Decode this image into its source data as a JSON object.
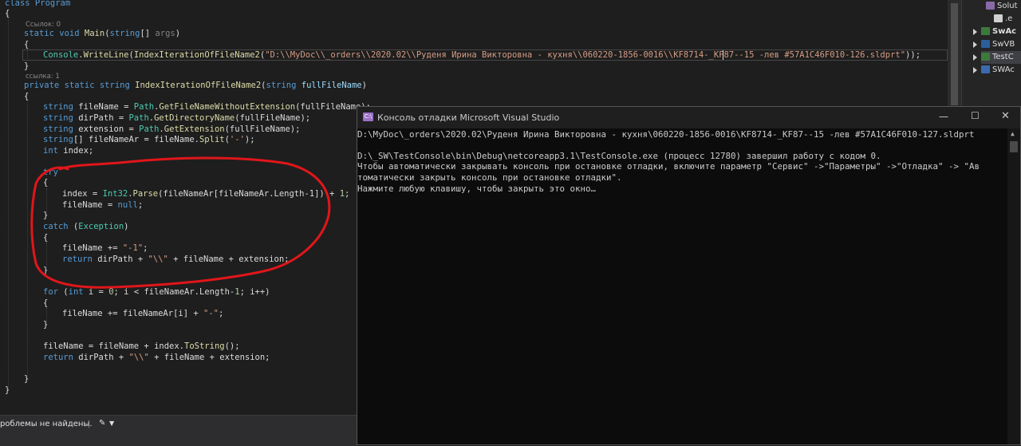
{
  "editor": {
    "class_line": "class Program",
    "open_brace": "{",
    "close_brace": "}",
    "refs_main": "Ссылок: 0",
    "refs_method": "ссылка: 1",
    "main_sig": {
      "kw1": "static",
      "kw2": "void",
      "name": "Main",
      "paren_open": "(",
      "kw3": "string",
      "rest": "[] ",
      "param": "args",
      "paren_close": ")"
    },
    "writeline": {
      "cls": "Console",
      "dot": ".",
      "mt": "WriteLine",
      "mid": "(",
      "mt2": "IndexIterationOfFileName2",
      "open": "(",
      "str": "\"D:\\\\MyDoc\\\\_orders\\\\2020.02\\\\Руденя Ирина Викторовна - кухня\\\\060220-1856-0016\\\\KF8714-_KF87--15 -лев #57A1C46F010-126.sldprt\"",
      "close": "));"
    },
    "method_sig": {
      "kw1": "private",
      "kw2": "static",
      "kw3": "string",
      "name": "IndexIterationOfFileName2",
      "open": "(",
      "kw4": "string",
      "param": " fullFileName",
      "close": ")"
    },
    "decl1": {
      "kw": "string",
      "rest": " fileName = ",
      "ty": "Path",
      "dot": ".",
      "mt": "GetFileNameWithoutExtension",
      "arg": "(fullFileName);"
    },
    "decl2": {
      "kw": "string",
      "rest": " dirPath = ",
      "ty": "Path",
      "dot": ".",
      "mt": "GetDirectoryName",
      "arg": "(fullFileName);"
    },
    "decl3": {
      "kw": "string",
      "rest": " extension = ",
      "ty": "Path",
      "dot": ".",
      "mt": "GetExtension",
      "arg": "(fullFileName);"
    },
    "decl4": {
      "kw": "string",
      "rest": "[] fileNameAr = fileName.",
      "mt": "Split",
      "open": "(",
      "str": "'-'",
      "close": ");"
    },
    "decl5": {
      "kw": "int",
      "rest": " index;"
    },
    "try_kw": "try",
    "idx_line": {
      "pre": "index = ",
      "ty": "Int32",
      "dot": ".",
      "mt": "Parse",
      "rest": "(fileNameAr[fileNameAr.Length-1]) + ",
      "num": "1",
      "end": ";"
    },
    "fn_null": {
      "pre": "fileName = ",
      "kw": "null",
      "end": ";"
    },
    "catch_line": {
      "kw": "catch",
      "open": " (",
      "ty": "Exception",
      "close": ")"
    },
    "fn_m1": {
      "pre": "fileName += ",
      "str": "\"-1\"",
      "end": ";"
    },
    "ret1": {
      "kw": "return",
      "pre": " dirPath + ",
      "str": "\"\\\\\"",
      "rest": " + fileName + extension;"
    },
    "for_line": {
      "kw": "for",
      "open": " (",
      "kw2": "int",
      "rest": " i = ",
      "num": "0",
      "rest2": "; i < fileNameAr.Length-",
      "num2": "1",
      "end": "; i++)"
    },
    "fn_loop": {
      "pre": "fileName += fileNameAr[i] + ",
      "str": "\"-\"",
      "end": ";"
    },
    "fn_final": {
      "pre": "fileName = fileName + index.",
      "mt": "ToString",
      "end": "();"
    },
    "ret2": {
      "kw": "return",
      "pre": " dirPath + ",
      "str": "\"\\\\\"",
      "rest": " + fileName + extension;"
    }
  },
  "status": {
    "text": "роблемы не найдены."
  },
  "solution": {
    "items": [
      "Solut",
      ".e",
      "SwAc",
      "SwVB",
      "TestC",
      "SWAc"
    ]
  },
  "console": {
    "title": "Консоль отладки Microsoft Visual Studio",
    "lines": [
      "D:\\MyDoc\\_orders\\2020.02\\Руденя Ирина Викторовна - кухня\\060220-1856-0016\\KF8714-_KF87--15 -лев #57A1C46F010-127.sldprt",
      "",
      "D:\\_SW\\TestConsole\\bin\\Debug\\netcoreapp3.1\\TestConsole.exe (процесс 12780) завершил работу с кодом 0.",
      "Чтобы автоматически закрывать консоль при остановке отладки, включите параметр \"Сервис\" ->\"Параметры\" ->\"Отладка\" -> \"Ав",
      "томатически закрыть консоль при остановке отладки\".",
      "Нажмите любую клавишу, чтобы закрыть это окно…"
    ]
  },
  "colors": {
    "annotation": "#e0161a",
    "console_bg": "#0c0c0c",
    "editor_bg": "#1e1e1e",
    "vs_purple": "#68217a"
  }
}
